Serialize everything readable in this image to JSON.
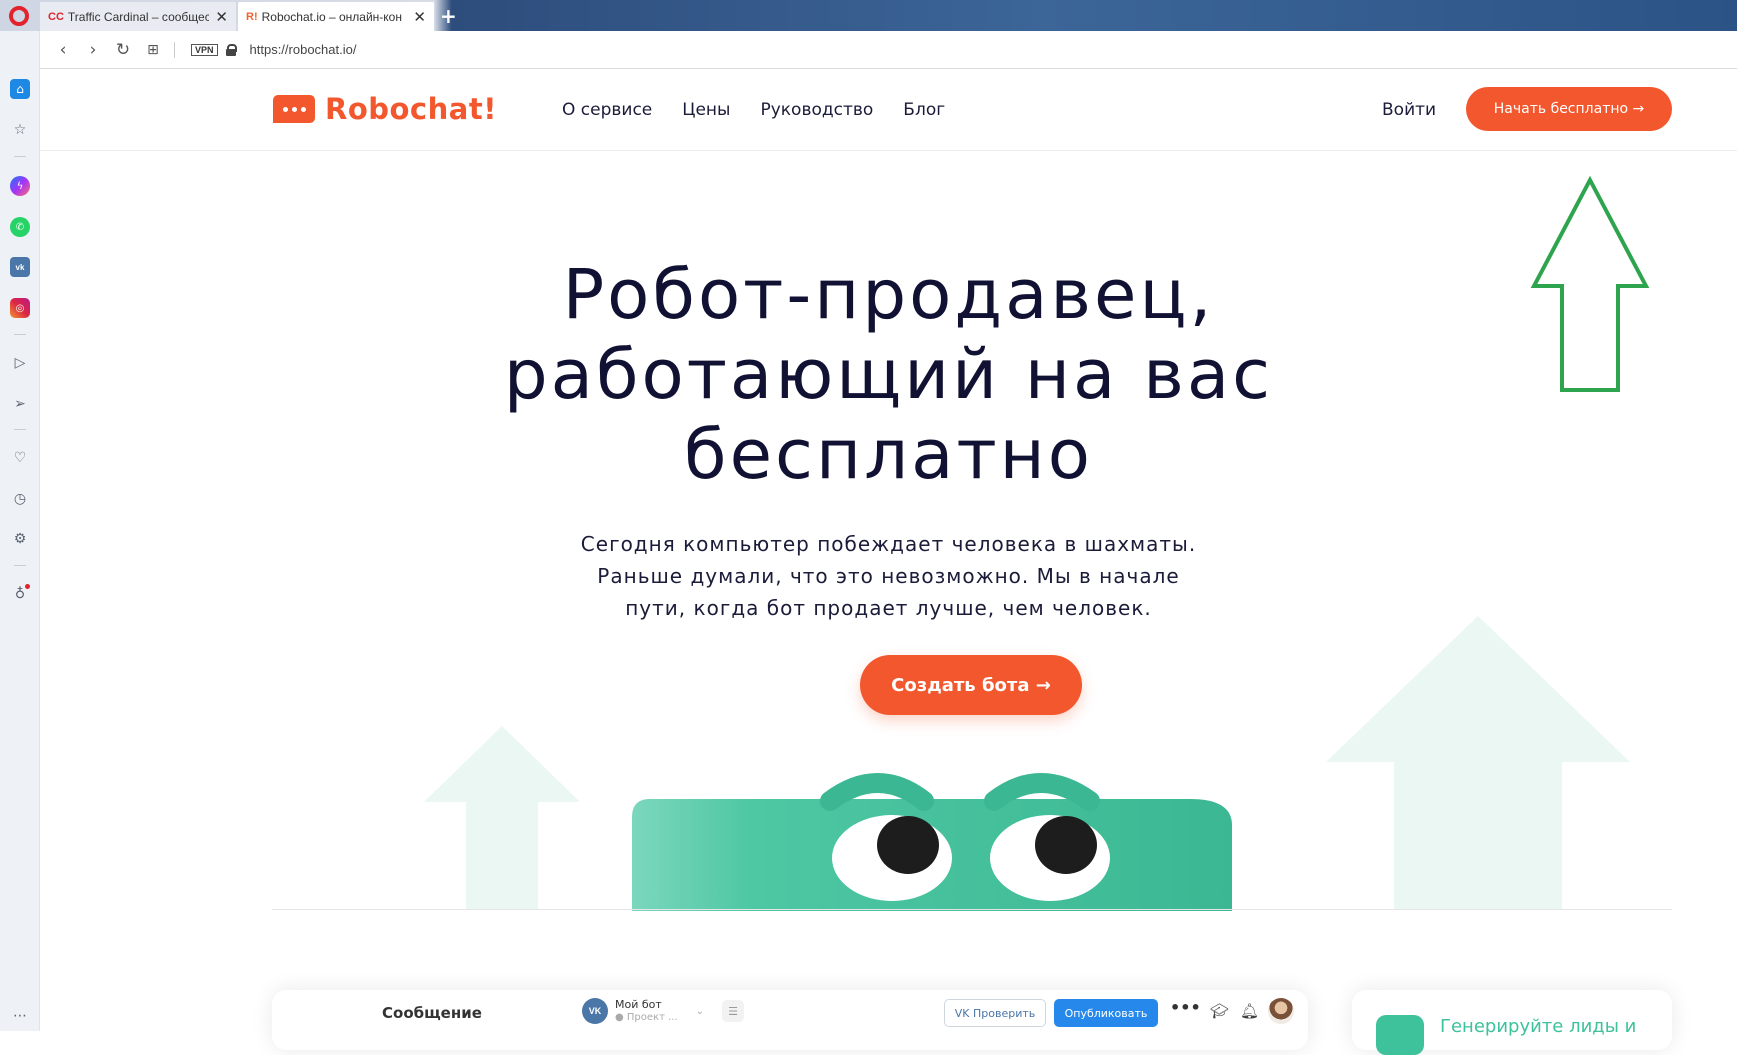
{
  "browser": {
    "tabs": [
      {
        "favicon": "CC",
        "title": "Traffic Cardinal – сообщест"
      },
      {
        "favicon": "R!",
        "title": "Robochat.io – онлайн-кон"
      }
    ],
    "new_tab": "+",
    "vpn_label": "VPN",
    "url": "https://robochat.io/"
  },
  "header": {
    "logo_text": "Robochat!",
    "nav": [
      "О сервисе",
      "Цены",
      "Руководство",
      "Блог"
    ],
    "login": "Войти",
    "cta": "Начать бесплатно →"
  },
  "hero": {
    "title_lines": [
      "Робот-продавец,",
      "работающий на вас",
      "бесплатно"
    ],
    "subtitle_lines": [
      "Сегодня компьютер побеждает человека в шахматы.",
      "Раньше думали, что это невозможно. Мы в начале",
      "пути, когда бот продает лучше, чем человек."
    ],
    "cta": "Создать бота →"
  },
  "preview": {
    "title": "Сообщение",
    "avatar_text": "VK",
    "bot_name": "Мой бот",
    "bot_project": "● Проект ...",
    "check_label": "VK Проверить",
    "publish_label": "Опубликовать",
    "more": "•••"
  },
  "side_card": {
    "text": "Генерируйте лиды и"
  },
  "colors": {
    "accent": "#f2572d",
    "robot_green": "#3ec29c",
    "annotation_green": "#2ea44f",
    "vk_blue": "#2688eb"
  },
  "icons": {
    "sidebar": [
      "home-icon",
      "bookmark-icon",
      "messenger-icon",
      "whatsapp-icon",
      "vk-icon",
      "instagram-icon",
      "player-icon",
      "send-icon",
      "heart-icon",
      "history-icon",
      "settings-icon",
      "lightbulb-icon",
      "more-icon"
    ],
    "annotation": "up-arrow-icon"
  }
}
